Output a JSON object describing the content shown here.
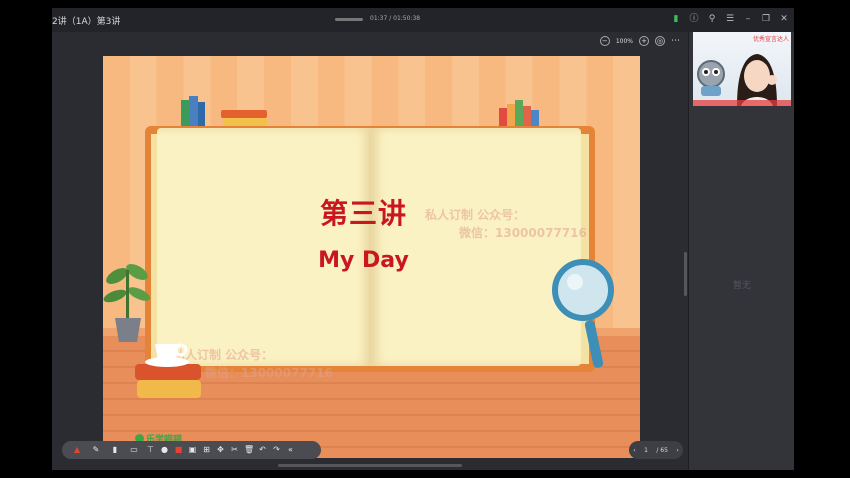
{
  "window": {
    "title": "2讲（1A）第3讲",
    "time": "01:37 / 01:50:38"
  },
  "titlebar_icons": [
    "signal-icon",
    "info-icon",
    "pin-icon",
    "menu-icon",
    "minimize-icon",
    "restore-icon",
    "close-icon"
  ],
  "zoom": {
    "level": "100%"
  },
  "slide": {
    "heading": "第三讲",
    "subtitle": "My Day",
    "watermark_1a": "私人订制 公众号：",
    "watermark_1b": "微信：13000077716",
    "watermark_2a": "私人订制 公众号：",
    "watermark_2b": "微信：13000077716",
    "logo_text": "乐学喵喵"
  },
  "pager": {
    "current": "1",
    "total": "/ 65"
  },
  "video": {
    "caption": "优秀宣言达人"
  },
  "side": {
    "label": "暂无"
  },
  "toolbar_icons": [
    "pointer-icon",
    "pen-icon",
    "highlighter-icon",
    "eraser-icon",
    "shape-icon",
    "text-icon",
    "color-icon",
    "fill-icon",
    "grid-icon",
    "move-icon",
    "cut-icon",
    "delete-icon",
    "undo-icon",
    "redo-icon",
    "collapse-icon"
  ]
}
